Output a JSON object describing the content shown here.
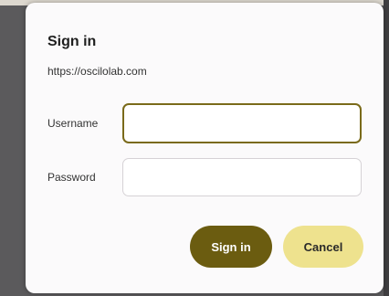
{
  "dialog": {
    "title": "Sign in",
    "origin": "https://oscilolab.com",
    "username": {
      "label": "Username",
      "value": "",
      "placeholder": ""
    },
    "password": {
      "label": "Password",
      "value": "",
      "placeholder": ""
    },
    "buttons": {
      "sign_in": "Sign in",
      "cancel": "Cancel"
    }
  },
  "colors": {
    "primary_button": "#6b5c10",
    "secondary_button": "#eee28e",
    "focus_border": "#7a6a1a",
    "dialog_background": "#fbfafb"
  }
}
